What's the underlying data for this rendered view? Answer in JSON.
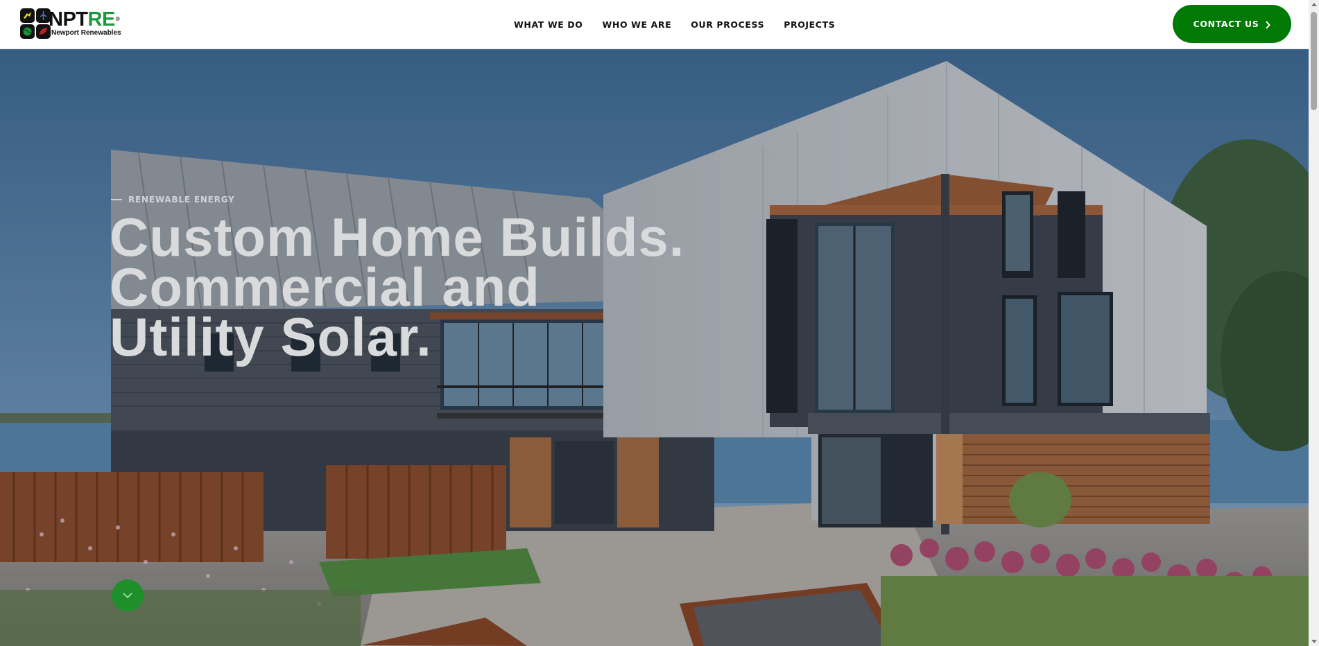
{
  "header": {
    "logo": {
      "wordmark_prefix": "NPT",
      "wordmark_suffix": "RE",
      "registered": "®",
      "subtitle": "Newport Renewables",
      "brand_green": "#1a9a3c"
    },
    "nav": [
      {
        "label": "WHAT WE DO"
      },
      {
        "label": "WHO WE ARE"
      },
      {
        "label": "OUR PROCESS"
      },
      {
        "label": "PROJECTS"
      }
    ],
    "contact_button": {
      "label": "CONTACT US",
      "icon": "chevron-right-icon",
      "color": "#007a05"
    }
  },
  "hero": {
    "eyebrow": "RENEWABLE ENERGY",
    "title_lines": [
      "Custom Home Builds.",
      "Commercial and",
      "Utility Solar."
    ],
    "scroll_button_icon": "chevron-down-icon",
    "image_subject": "modern house"
  }
}
